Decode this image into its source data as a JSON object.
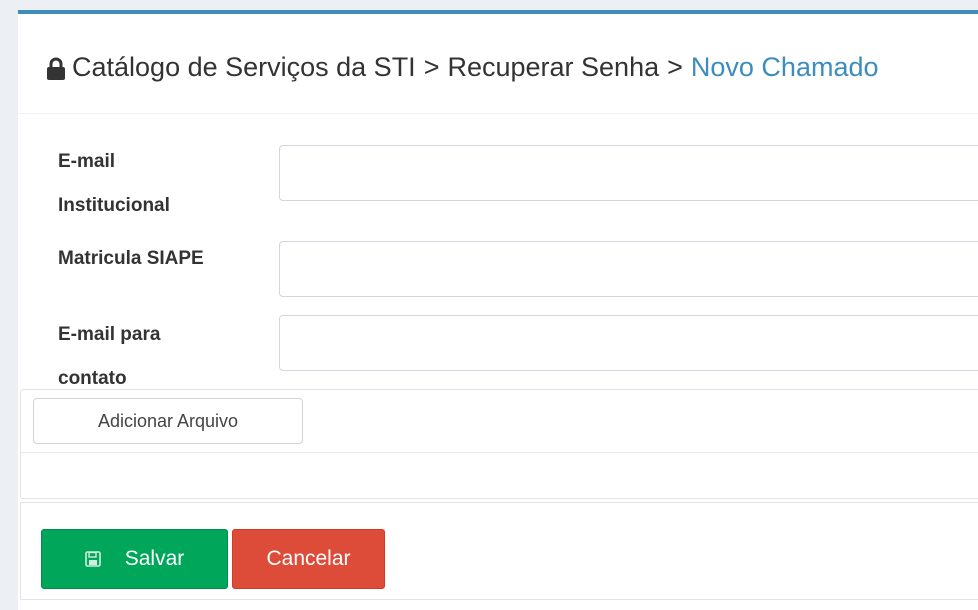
{
  "header": {
    "crumbs": [
      "Catálogo de Serviços da STI",
      "Recuperar Senha",
      "Novo Chamado"
    ],
    "separator": ">"
  },
  "form": {
    "fields": [
      {
        "label_line1": "E-mail",
        "label_line2": "Institucional",
        "value": ""
      },
      {
        "label_line1": "Matricula SIAPE",
        "value": ""
      },
      {
        "label_line1": "E-mail para",
        "label_line2": "contato",
        "value": ""
      }
    ],
    "attach_label": "Adicionar Arquivo"
  },
  "actions": {
    "save_label": "Salvar",
    "cancel_label": "Cancelar"
  },
  "colors": {
    "accent": "#3c8dbc",
    "save": "#00a65a",
    "cancel": "#dd4b39"
  },
  "icons": [
    "lock-icon",
    "floppy-disk-icon"
  ]
}
